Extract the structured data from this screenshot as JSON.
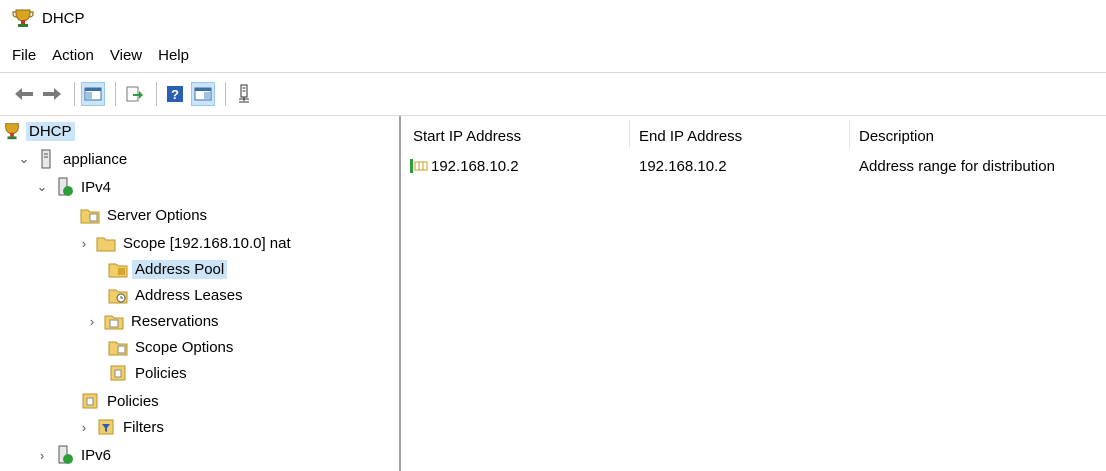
{
  "window": {
    "title": "DHCP"
  },
  "menu": {
    "file": "File",
    "action": "Action",
    "view": "View",
    "help": "Help"
  },
  "toolbar": {
    "buttons": [
      "back-icon",
      "forward-icon",
      "show-hide-tree-icon",
      "export-list-icon",
      "help-icon",
      "show-action-pane-icon",
      "server-icon"
    ]
  },
  "tree": {
    "root": "DHCP",
    "server": "appliance",
    "ipv4": "IPv4",
    "server_options": "Server Options",
    "scope": "Scope [192.168.10.0] nat",
    "address_pool": "Address Pool",
    "address_leases": "Address Leases",
    "reservations": "Reservations",
    "scope_options": "Scope Options",
    "scope_policies": "Policies",
    "policies": "Policies",
    "filters": "Filters",
    "ipv6": "IPv6"
  },
  "list": {
    "columns": [
      "Start IP Address",
      "End IP Address",
      "Description"
    ],
    "rows": [
      {
        "start": "192.168.10.2",
        "end": "192.168.10.2",
        "description": "Address range for distribution"
      }
    ]
  }
}
